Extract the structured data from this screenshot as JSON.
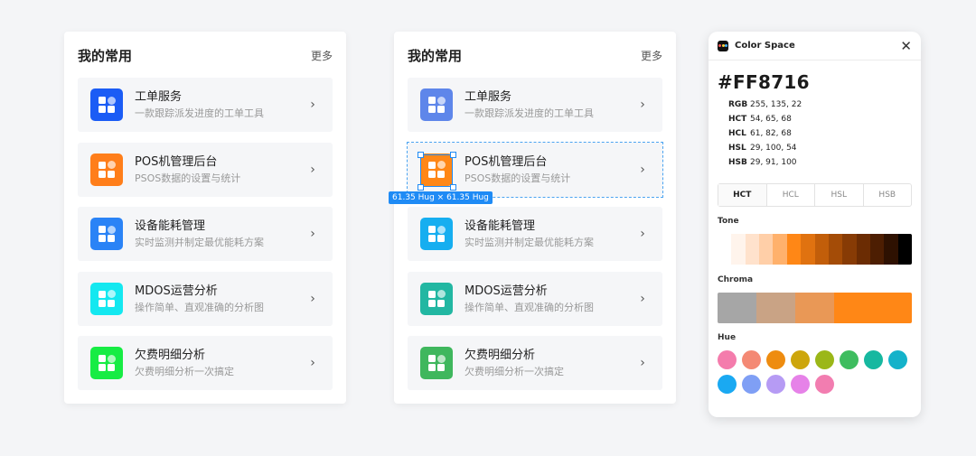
{
  "left_card": {
    "title": "我的常用",
    "more": "更多",
    "items": [
      {
        "title": "工单服务",
        "desc": "一款跟踪派发进度的工单工具",
        "color": "#1b5cf5"
      },
      {
        "title": "POS机管理后台",
        "desc": "PSOS数据的设置与统计",
        "color": "#ff7e1a"
      },
      {
        "title": "设备能耗管理",
        "desc": "实时监测并制定最优能耗方案",
        "color": "#2a83f6"
      },
      {
        "title": "MDOS运营分析",
        "desc": "操作简单、直观准确的分析图",
        "color": "#14e8f0"
      },
      {
        "title": "欠费明细分析",
        "desc": "欠费明细分析一次搞定",
        "color": "#17ec44"
      }
    ]
  },
  "mid_card": {
    "title": "我的常用",
    "more": "更多",
    "size_tag": "61.35 Hug × 61.35 Hug",
    "items": [
      {
        "title": "工单服务",
        "desc": "一款跟踪派发进度的工单工具",
        "color": "#5e86ea"
      },
      {
        "title": "POS机管理后台",
        "desc": "PSOS数据的设置与统计",
        "color": "#ff8716"
      },
      {
        "title": "设备能耗管理",
        "desc": "实时监测并制定最优能耗方案",
        "color": "#16aef0"
      },
      {
        "title": "MDOS运营分析",
        "desc": "操作简单、直观准确的分析图",
        "color": "#22b7a2"
      },
      {
        "title": "欠费明细分析",
        "desc": "欠费明细分析一次搞定",
        "color": "#3fb75d"
      }
    ]
  },
  "panel": {
    "title": "Color Space",
    "hex": "#FF8716",
    "values": [
      {
        "k": "RGB",
        "v": "255, 135, 22"
      },
      {
        "k": "HCT",
        "v": "54, 65, 68"
      },
      {
        "k": "HCL",
        "v": "61, 82, 68"
      },
      {
        "k": "HSL",
        "v": "29, 100, 54"
      },
      {
        "k": "HSB",
        "v": "29, 91, 100"
      }
    ],
    "tabs": [
      "HCT",
      "HCL",
      "HSL",
      "HSB"
    ],
    "tone_label": "Tone",
    "chroma_label": "Chroma",
    "hue_label": "Hue",
    "tone_colors": [
      "#ffffff",
      "#fff4ec",
      "#ffe2cc",
      "#ffcfa8",
      "#ffb16c",
      "#ff8716",
      "#e07210",
      "#c25e0a",
      "#a44c07",
      "#873b05",
      "#6b2c03",
      "#4d1e02",
      "#2e1101",
      "#000000"
    ],
    "chroma_colors": [
      "#a6a6a6",
      "#a6a6a6",
      "#c9a385",
      "#c9a385",
      "#e99856",
      "#e99856",
      "#ff8716",
      "#ff8716",
      "#ff8716",
      "#ff8716"
    ],
    "hue_colors": [
      "#f47cac",
      "#f48974",
      "#ee8c10",
      "#cda60c",
      "#9bb718",
      "#3ebd5f",
      "#17b8a0",
      "#14b2ca",
      "#1aa9f2",
      "#7f9ff5",
      "#b69bf4",
      "#e682e8",
      "#f27db0"
    ]
  }
}
